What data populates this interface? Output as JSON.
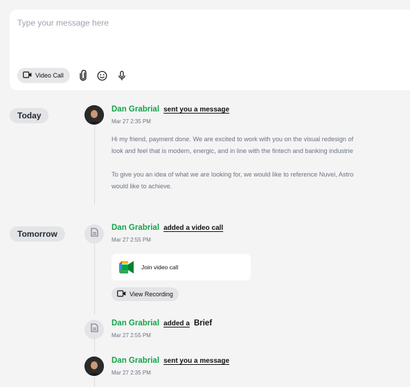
{
  "composer": {
    "placeholder": "Type your message here",
    "video_call_label": "Video Call"
  },
  "days": {
    "today": "Today",
    "tomorrow": "Tomorrow"
  },
  "events": [
    {
      "name": "Dan Grabrial",
      "action": "sent you a message",
      "time": "Mar 27 2:35 PM",
      "lines": [
        "Hi my friend, payment done. We are excited to work with you on the visual redesign of",
        "look and feel that is modern, energic, and in line with the fintech and banking industrie",
        "To give you an idea of what we are looking for, we would like to reference Nuvei, Astro",
        "would like to achieve."
      ]
    },
    {
      "name": "Dan Grabrial",
      "action": "added a video call",
      "time": "Mar 27 2:55 PM",
      "join_label": "Join video call",
      "recording_label": "View Recording"
    },
    {
      "name": "Dan Grabrial",
      "action": "added a",
      "object": "Brief",
      "time": "Mar 27 2:55 PM"
    },
    {
      "name": "Dan Grabrial",
      "action": "sent you a message",
      "time": "Mar 27 2:35 PM"
    }
  ],
  "colors": {
    "name_green": "#16a34a",
    "background": "#f4f4f5"
  }
}
